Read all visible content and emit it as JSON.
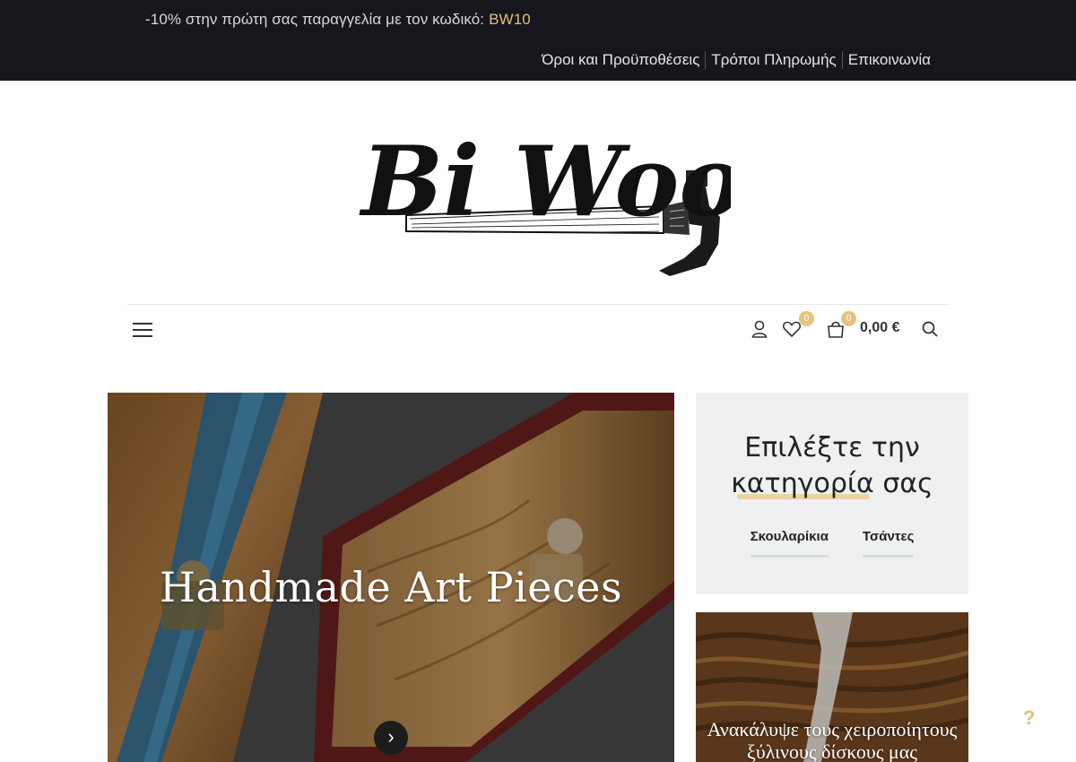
{
  "topbar": {
    "promo_text": "-10% στην πρώτη σας παραγγελία με τον κωδικό:",
    "promo_code": "BW10",
    "links": [
      "Όροι και Προϋποθέσεις",
      "Τρόποι Πληρωμής",
      "Επικοινωνία"
    ]
  },
  "logo": {
    "text": "Bi Wood"
  },
  "nav": {
    "wishlist_count": "0",
    "cart_count": "0",
    "cart_total": "0,00 €",
    "icons": [
      "menu-icon",
      "user-icon",
      "heart-icon",
      "bag-icon",
      "search-icon"
    ]
  },
  "hero": {
    "title": "Handmade Art Pieces",
    "next_glyph": "›"
  },
  "category": {
    "title_line1": "Επιλέξτε την",
    "title_line2_highlight": "κατηγορία",
    "title_line2_rest": "σας",
    "links": [
      "Σκουλαρίκια",
      "Τσάντες"
    ]
  },
  "tile": {
    "line1": "Ανακάλυψε τους χειροποίητους",
    "line2": "ξύλινους δίσκους μας"
  },
  "help": {
    "glyph": "?"
  },
  "colors": {
    "topbar": "#17161d",
    "accent": "#e2c07d",
    "badge": "#e7c27c",
    "category_bg": "#eef0f1"
  }
}
